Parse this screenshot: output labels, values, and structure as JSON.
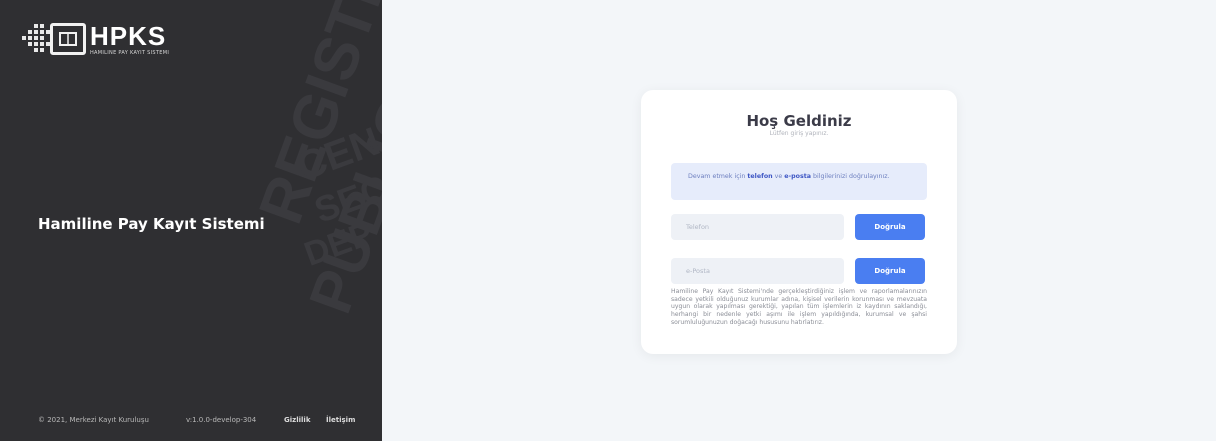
{
  "brand": {
    "logo_text": "HPKS",
    "logo_subtitle": "HAMILINE PAY KAYIT SISTEMI",
    "title": "Hamiline Pay Kayıt Sistemi",
    "watermark": [
      "REGISTRY",
      "PUBLIC",
      "CEN",
      "SEC",
      "DEP"
    ]
  },
  "footer": {
    "copyright": "© 2021, Merkezi Kayıt Kuruluşu",
    "version": "v:1.0.0-develop-304",
    "privacy_link": "Gizlilik",
    "contact_link": "İletişim"
  },
  "login": {
    "title": "Hoş Geldiniz",
    "subtitle": "Lütfen giriş yapınız.",
    "info_prefix": "Devam etmek için ",
    "info_phone": "telefon",
    "info_mid": " ve ",
    "info_email": "e-posta",
    "info_suffix": " bilgilerinizi doğrulayınız.",
    "phone_placeholder": "Telefon",
    "phone_button": "Doğrula",
    "email_placeholder": "e-Posta",
    "email_button": "Doğrula",
    "disclaimer": "Hamiline Pay Kayıt Sistemi'nde gerçekleştirdiğiniz işlem ve raporlamalarınızın sadece yetkili olduğunuz kurumlar adına, kişisel verilerin korunması ve mevzuata uygun olarak yapılması gerektiği, yapılan tüm işlemlerin iz kaydının saklandığı, herhangi bir nedenle yetki aşımı ile işlem yapıldığında, kurumsal ve şahsi sorumluluğunuzun doğacağı hususunu hatırlatırız."
  },
  "colors": {
    "sidebar_bg": "#2f2f32",
    "page_bg": "#f3f6f9",
    "primary": "#4a7ef1",
    "info_bg": "#e6ecfb"
  }
}
